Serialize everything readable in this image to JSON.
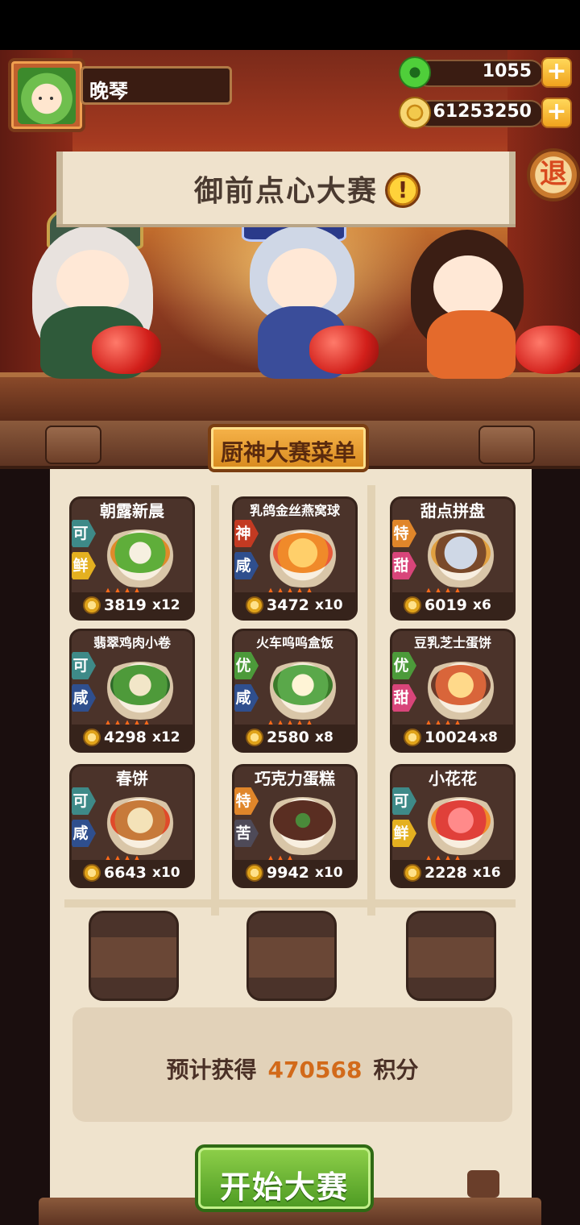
{
  "player": {
    "name": "晚琴"
  },
  "resources": {
    "jade": "1055",
    "gold": "61253250"
  },
  "exit_label": "退",
  "event": {
    "title": "御前点心大赛",
    "info_icon": "!"
  },
  "menu": {
    "title": "厨神大赛菜单",
    "dishes": [
      {
        "name": "朝露新晨",
        "grade": "可",
        "flavor": "鲜",
        "price": "3819",
        "qty": "x12"
      },
      {
        "name": "乳鸽金丝燕窝球",
        "grade": "神",
        "flavor": "咸",
        "price": "3472",
        "qty": "x10"
      },
      {
        "name": "甜点拼盘",
        "grade": "特",
        "flavor": "甜",
        "price": "6019",
        "qty": "x6"
      },
      {
        "name": "翡翠鸡肉小卷",
        "grade": "可",
        "flavor": "咸",
        "price": "4298",
        "qty": "x12"
      },
      {
        "name": "火车呜呜盒饭",
        "grade": "优",
        "flavor": "咸",
        "price": "2580",
        "qty": "x8"
      },
      {
        "name": "豆乳芝士蛋饼",
        "grade": "优",
        "flavor": "甜",
        "price": "10024",
        "qty": "x8"
      },
      {
        "name": "春饼",
        "grade": "可",
        "flavor": "咸",
        "price": "6643",
        "qty": "x10"
      },
      {
        "name": "巧克力蛋糕",
        "grade": "特",
        "flavor": "苦",
        "price": "9942",
        "qty": "x10"
      },
      {
        "name": "小花花",
        "grade": "可",
        "flavor": "鲜",
        "price": "2228",
        "qty": "x16"
      }
    ]
  },
  "estimate": {
    "prefix": "预计获得",
    "points": "470568",
    "suffix": "积分"
  },
  "start_button": "开始大赛",
  "colors": {
    "grade_keke": "#3e8a88",
    "grade_shen": "#c33a22",
    "grade_te": "#e0862a",
    "grade_you": "#4c9a3a",
    "accent_points": "#d26a1a"
  }
}
